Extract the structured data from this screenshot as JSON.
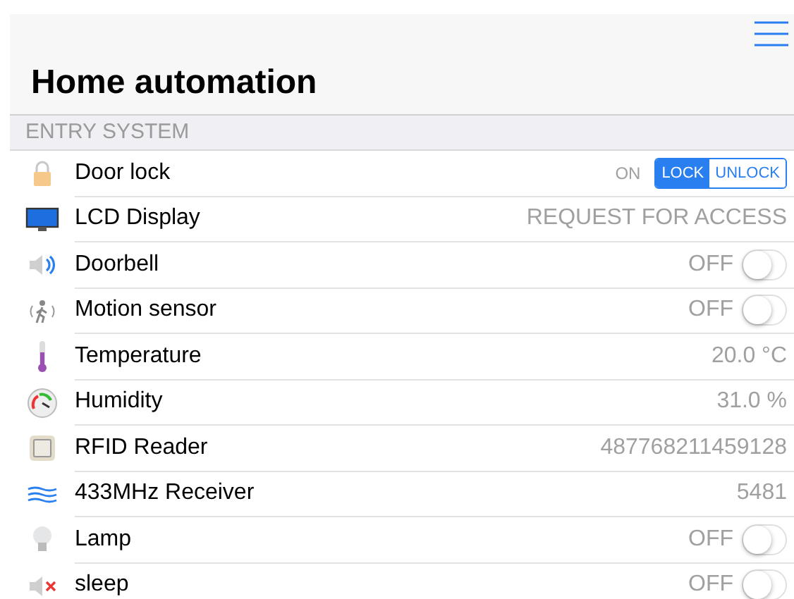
{
  "title": "Home automation",
  "section": "ENTRY SYSTEM",
  "rows": [
    {
      "name": "Door lock",
      "kind": "segmented",
      "status": "ON",
      "segments": [
        {
          "label": "LOCK",
          "selected": true
        },
        {
          "label": "UNLOCK",
          "selected": false
        }
      ]
    },
    {
      "name": "LCD Display",
      "kind": "text",
      "value": "REQUEST FOR ACCESS"
    },
    {
      "name": "Doorbell",
      "kind": "switch",
      "status": "OFF",
      "on": false
    },
    {
      "name": "Motion sensor",
      "kind": "switch",
      "status": "OFF",
      "on": false
    },
    {
      "name": "Temperature",
      "kind": "text",
      "value": "20.0 °C"
    },
    {
      "name": "Humidity",
      "kind": "text",
      "value": "31.0 %"
    },
    {
      "name": "RFID Reader",
      "kind": "text",
      "value": "487768211459128"
    },
    {
      "name": "433MHz Receiver",
      "kind": "text",
      "value": "5481"
    },
    {
      "name": "Lamp",
      "kind": "switch",
      "status": "OFF",
      "on": false
    },
    {
      "name": "sleep",
      "kind": "switch",
      "status": "OFF",
      "on": false
    }
  ]
}
